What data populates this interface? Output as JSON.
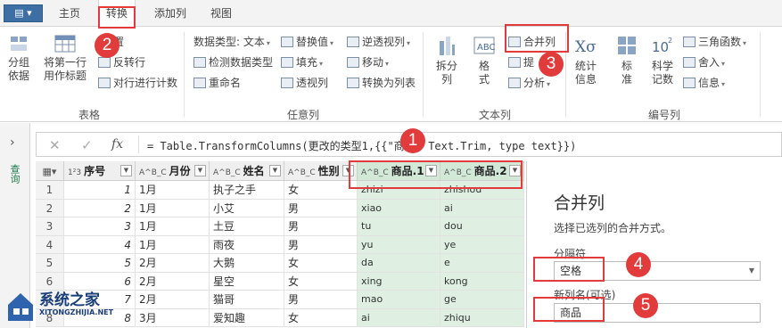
{
  "tabs": {
    "home": "主页",
    "transform": "转换",
    "add_column": "添加列",
    "view": "视图"
  },
  "ribbon": {
    "group_by": "分组\n依据",
    "first_row_header": "将第一行\n用作标题",
    "transpose_partial": "置",
    "reverse_rows": "反转行",
    "count_rows": "对行进行计数",
    "table_group": "表格",
    "data_type": "数据类型: 文本",
    "detect_type": "检测数据类型",
    "rename": "重命名",
    "replace_values": "替换值",
    "fill": "填充",
    "pivot_column": "透视列",
    "unpivot": "逆透视列",
    "move": "移动",
    "convert_to_list": "转换为列表",
    "any_column_group": "任意列",
    "split_column": "拆分\n列",
    "format": "格\n式",
    "merge_columns": "合并列",
    "extract_partial": "提",
    "analyze": "分析",
    "text_column_group": "文本列",
    "statistics": "统计\n信息",
    "standard": "标\n准",
    "scientific": "科学\n记数",
    "trig": "三角函数",
    "rounding": "舍入",
    "info": "信息",
    "number_column_group": "编号列"
  },
  "formula": {
    "fx": "fx",
    "text": "= Table.TransformColumns(更改的类型1,{{\"商品.    Text.Trim, type text}})"
  },
  "table": {
    "headers": [
      {
        "type": "1²3",
        "label": "序号"
      },
      {
        "type": "A^B_C",
        "label": "月份"
      },
      {
        "type": "A^B_C",
        "label": "姓名"
      },
      {
        "type": "A^B_C",
        "label": "性别"
      },
      {
        "type": "A^B_C",
        "label": "商品.1"
      },
      {
        "type": "A^B_C",
        "label": "商品.2"
      }
    ],
    "rows": [
      {
        "rn": "1",
        "id": "1",
        "month": "1月",
        "name": "执子之手",
        "sex": "女",
        "p1": "zhizi",
        "p2": "zhishou"
      },
      {
        "rn": "2",
        "id": "2",
        "month": "1月",
        "name": "小艾",
        "sex": "男",
        "p1": "xiao",
        "p2": "ai"
      },
      {
        "rn": "3",
        "id": "3",
        "month": "1月",
        "name": "土豆",
        "sex": "男",
        "p1": "tu",
        "p2": "dou"
      },
      {
        "rn": "4",
        "id": "4",
        "month": "1月",
        "name": "雨夜",
        "sex": "男",
        "p1": "yu",
        "p2": "ye"
      },
      {
        "rn": "5",
        "id": "5",
        "month": "2月",
        "name": "大鹅",
        "sex": "女",
        "p1": "da",
        "p2": "e"
      },
      {
        "rn": "6",
        "id": "6",
        "month": "2月",
        "name": "星空",
        "sex": "女",
        "p1": "xing",
        "p2": "kong"
      },
      {
        "rn": "7",
        "id": "7",
        "month": "2月",
        "name": "猫哥",
        "sex": "男",
        "p1": "mao",
        "p2": "ge"
      },
      {
        "rn": "8",
        "id": "8",
        "month": "3月",
        "name": "爱知趣",
        "sex": "女",
        "p1": "ai",
        "p2": "zhiqu"
      }
    ]
  },
  "panel": {
    "title": "合并列",
    "desc": "选择已选列的合并方式。",
    "separator_label": "分隔符",
    "separator_value": "空格",
    "new_col_label": "新列名(可选)",
    "new_col_value": "商品"
  },
  "badges": [
    "1",
    "2",
    "3",
    "4",
    "5"
  ],
  "rail_label": "查询",
  "watermark": {
    "name": "系统之家",
    "url": "XITONGZHIJIA.NET"
  },
  "colors": {
    "annotation": "#e23b3b",
    "selected_column": "#dff0e3",
    "app_button": "#3d6fa5"
  }
}
